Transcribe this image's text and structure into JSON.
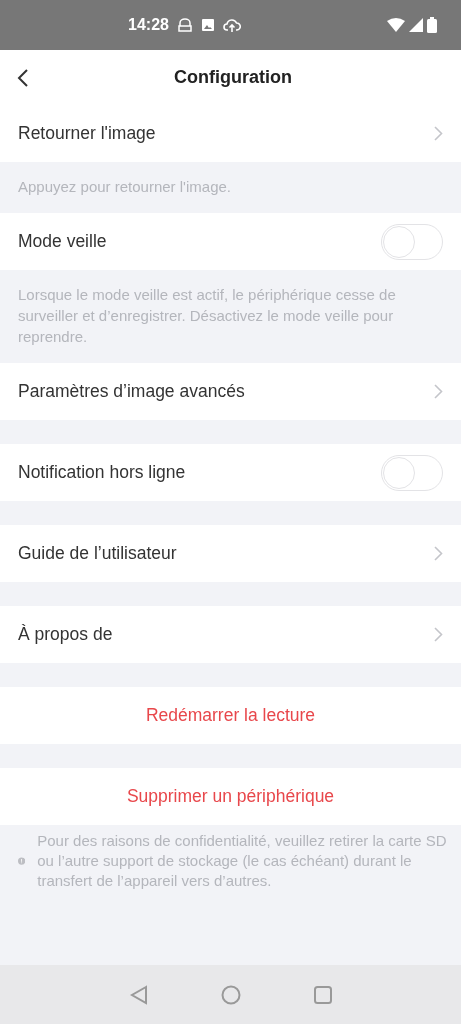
{
  "status_bar": {
    "time": "14:28"
  },
  "header": {
    "title": "Configuration"
  },
  "items": [
    {
      "kind": "link",
      "label": "Retourner l'image",
      "note": "Appuyez pour retourner l'image."
    },
    {
      "kind": "toggle",
      "label": "Mode veille",
      "on": false,
      "note": "Lorsque le mode veille est actif, le périphérique cesse de surveiller et d’enregistrer. Désactivez le mode veille pour reprendre."
    },
    {
      "kind": "link",
      "label": "Paramètres d’image avancés"
    },
    {
      "kind": "toggle",
      "label": "Notification hors ligne",
      "on": false
    },
    {
      "kind": "link",
      "label": "Guide de l’utilisateur"
    },
    {
      "kind": "link",
      "label": "À propos de"
    },
    {
      "kind": "action",
      "label": "Redémarrer la lecture"
    },
    {
      "kind": "action",
      "label": "Supprimer un périphérique"
    }
  ],
  "warning": "Pour des raisons de confidentialité, veuillez retirer la carte SD ou l’autre support de stockage (le cas échéant) durant le transfert de l’appareil vers d’autres."
}
